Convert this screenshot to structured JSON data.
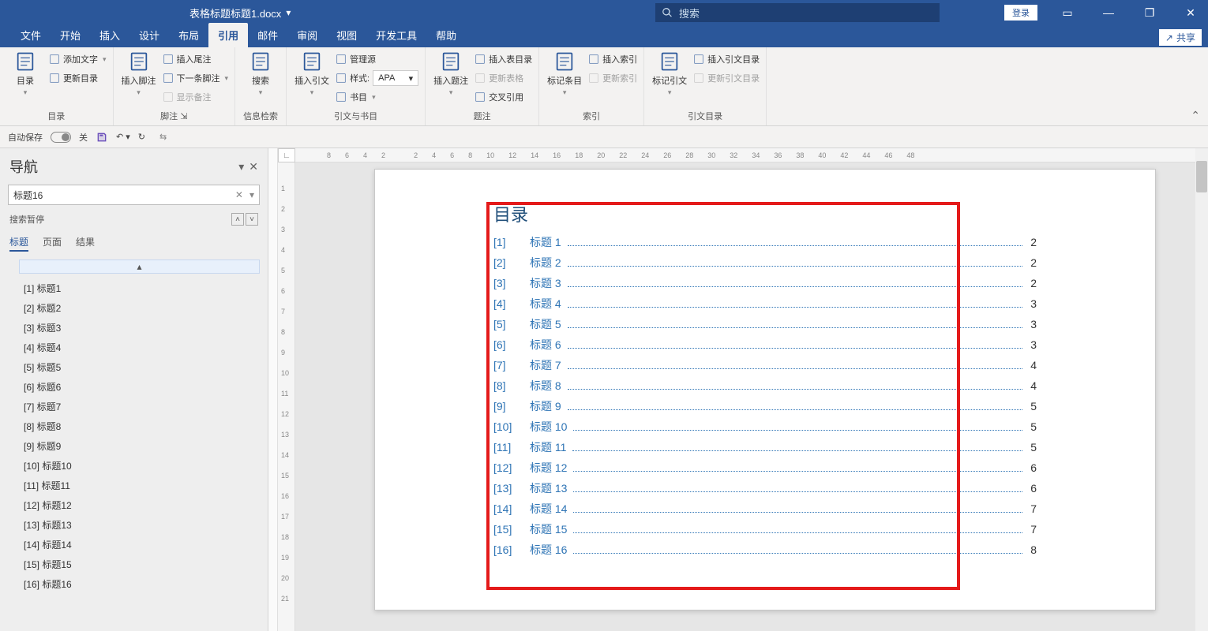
{
  "titlebar": {
    "filename": "表格标题标题1.docx",
    "search_placeholder": "搜索",
    "login": "登录"
  },
  "tabs": {
    "items": [
      "文件",
      "开始",
      "插入",
      "设计",
      "布局",
      "引用",
      "邮件",
      "审阅",
      "视图",
      "开发工具",
      "帮助"
    ],
    "active": 5,
    "share": "共享"
  },
  "ribbon": {
    "groups": [
      {
        "label": "目录",
        "big": "目录",
        "items": [
          {
            "label": "添加文字",
            "drop": true
          },
          {
            "label": "更新目录"
          }
        ]
      },
      {
        "label": "脚注",
        "big": "插入脚注",
        "items": [
          {
            "label": "插入尾注"
          },
          {
            "label": "下一条脚注",
            "drop": true
          },
          {
            "label": "显示备注",
            "disabled": true
          }
        ],
        "launcher": true
      },
      {
        "label": "信息检索",
        "big": "搜索"
      },
      {
        "label": "引文与书目",
        "big": "插入引文",
        "items": [
          {
            "label": "管理源"
          },
          {
            "label": "样式:",
            "select": "APA"
          },
          {
            "label": "书目",
            "drop": true
          }
        ]
      },
      {
        "label": "题注",
        "big": "插入题注",
        "items": [
          {
            "label": "插入表目录"
          },
          {
            "label": "更新表格",
            "disabled": true
          },
          {
            "label": "交叉引用"
          }
        ]
      },
      {
        "label": "索引",
        "big": "标记条目",
        "items": [
          {
            "label": "插入索引"
          },
          {
            "label": "更新索引",
            "disabled": true
          }
        ]
      },
      {
        "label": "引文目录",
        "big": "标记引文",
        "items": [
          {
            "label": "插入引文目录"
          },
          {
            "label": "更新引文目录",
            "disabled": true
          }
        ]
      }
    ]
  },
  "qat": {
    "autosave": "自动保存",
    "autosave_state": "关"
  },
  "nav": {
    "title": "导航",
    "search_value": "标题16",
    "paused": "搜索暂停",
    "tabs": [
      "标题",
      "页面",
      "结果"
    ],
    "active_tab": 0,
    "collapse_label": "▴",
    "items": [
      "[1] 标题1",
      "[2] 标题2",
      "[3] 标题3",
      "[4] 标题4",
      "[5] 标题5",
      "[6] 标题6",
      "[7] 标题7",
      "[8] 标题8",
      "[9] 标题9",
      "[10] 标题10",
      "[11] 标题11",
      "[12] 标题12",
      "[13] 标题13",
      "[14] 标题14",
      "[15] 标题15",
      "[16] 标题16"
    ]
  },
  "hruler": [
    "8",
    "6",
    "4",
    "2",
    "",
    "2",
    "4",
    "6",
    "8",
    "10",
    "12",
    "14",
    "16",
    "18",
    "20",
    "22",
    "24",
    "26",
    "28",
    "30",
    "32",
    "34",
    "36",
    "38",
    "40",
    "42",
    "44",
    "46",
    "48"
  ],
  "vruler": [
    "",
    "1",
    "2",
    "3",
    "4",
    "5",
    "6",
    "7",
    "8",
    "9",
    "10",
    "11",
    "12",
    "13",
    "14",
    "15",
    "16",
    "17",
    "18",
    "19",
    "20",
    "21"
  ],
  "doc": {
    "toc_title": "目录",
    "toc": [
      {
        "idx": "[1]",
        "title": "标题 1",
        "page": "2"
      },
      {
        "idx": "[2]",
        "title": "标题 2",
        "page": "2"
      },
      {
        "idx": "[3]",
        "title": "标题 3",
        "page": "2"
      },
      {
        "idx": "[4]",
        "title": "标题 4",
        "page": "3"
      },
      {
        "idx": "[5]",
        "title": "标题 5",
        "page": "3"
      },
      {
        "idx": "[6]",
        "title": "标题 6",
        "page": "3"
      },
      {
        "idx": "[7]",
        "title": "标题 7",
        "page": "4"
      },
      {
        "idx": "[8]",
        "title": "标题 8",
        "page": "4"
      },
      {
        "idx": "[9]",
        "title": "标题 9",
        "page": "5"
      },
      {
        "idx": "[10]",
        "title": "标题 10",
        "page": "5"
      },
      {
        "idx": "[11]",
        "title": "标题 11",
        "page": "5"
      },
      {
        "idx": "[12]",
        "title": "标题 12",
        "page": "6"
      },
      {
        "idx": "[13]",
        "title": "标题 13",
        "page": "6"
      },
      {
        "idx": "[14]",
        "title": "标题 14",
        "page": "7"
      },
      {
        "idx": "[15]",
        "title": "标题 15",
        "page": "7"
      },
      {
        "idx": "[16]",
        "title": "标题 16",
        "page": "8"
      }
    ]
  }
}
